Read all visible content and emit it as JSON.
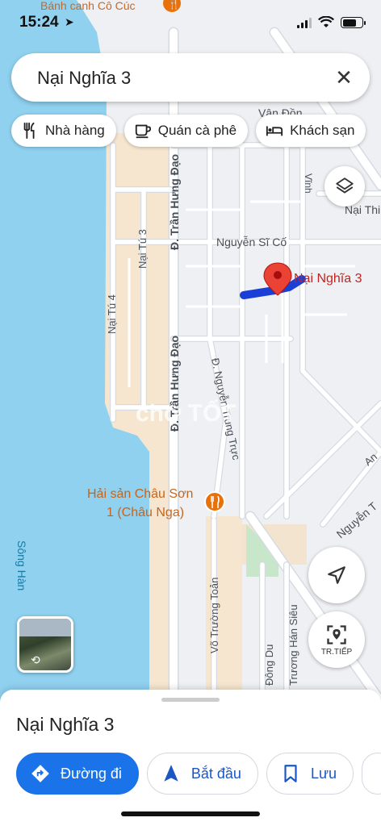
{
  "status_bar": {
    "time": "15:24",
    "location_arrow": "location-arrow-icon"
  },
  "search": {
    "query": "Nại Nghĩa 3",
    "close_icon": "close-icon"
  },
  "chips": [
    {
      "label": "Nhà hàng",
      "icon": "restaurant-icon"
    },
    {
      "label": "Quán cà phê",
      "icon": "coffee-icon"
    },
    {
      "label": "Khách sạn",
      "icon": "hotel-icon"
    }
  ],
  "map": {
    "colors": {
      "water": "#8fd1ef",
      "land": "#eef0f3",
      "road": "#ffffff",
      "road_edge": "#d6dbe2",
      "beach": "#f6e6cf",
      "park": "#c8e6c9",
      "route": "#1a3fd6",
      "pin": "#ea4335",
      "poi_orange": "#e8710a",
      "label": "#4a4f57"
    },
    "labels": {
      "banh_canh": "Bánh canh Cô Cúc",
      "van_don": "Vân Đồn",
      "tran_hung_dao_1": "Đ. Trần Hưng Đạo",
      "tran_hung_dao_2": "Đ. Trần Hưng Đạo",
      "nai_tu_3": "Nại Tú 3",
      "nai_tu_4": "Nại Tú 4",
      "nguyen_si_co": "Nguyễn Sĩ Cố",
      "nai_thi": "Nại Thi",
      "nguyen_trung_truc": "Đ. Nguyễn Trung Trực",
      "hai_san_1": "Hải sản Châu Sơn",
      "hai_san_2": "1 (Châu Nga)",
      "song_han": "Sông Hàn",
      "vo_truong_toan": "Võ Trường Toản",
      "dong_du": "Đông Du",
      "han_sieu": "Trương Hán Siêu",
      "nguyen_t": "Nguyễn T",
      "an": "An",
      "vinh": "Vĩnh",
      "watermark": "chợ TỐT"
    },
    "pin_label": "Nại Nghĩa 3"
  },
  "controls": {
    "layers_icon": "layers-icon",
    "navigate_icon": "navigate-arrow-icon",
    "live_label": "TR.TIẾP"
  },
  "sheet": {
    "title": "Nại Nghĩa 3",
    "actions": [
      {
        "label": "Đường đi",
        "icon": "directions-icon"
      },
      {
        "label": "Bắt đầu",
        "icon": "start-navigation-icon"
      },
      {
        "label": "Lưu",
        "icon": "bookmark-icon"
      }
    ]
  }
}
